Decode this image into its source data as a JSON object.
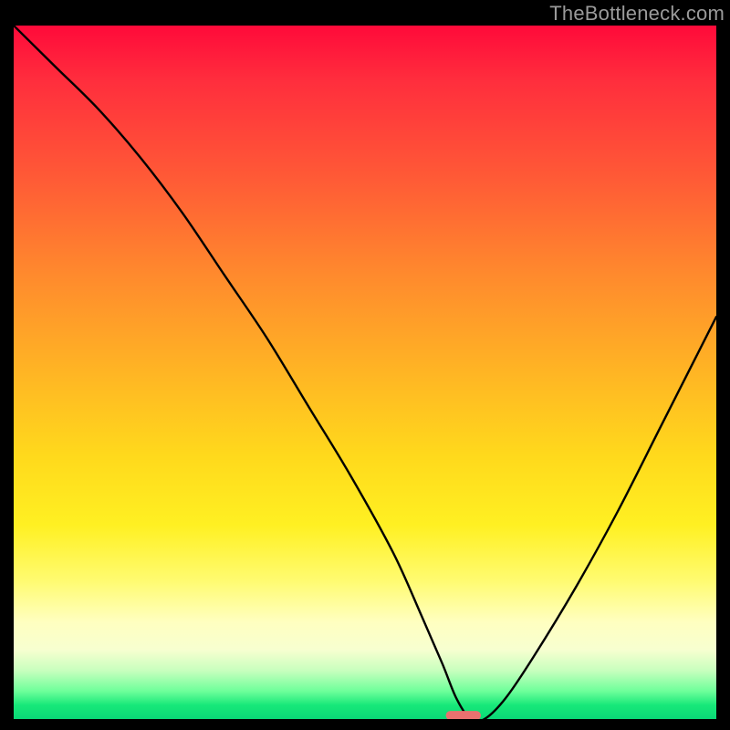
{
  "watermark": {
    "text": "TheBottleneck.com"
  },
  "chart_data": {
    "type": "line",
    "title": "",
    "xlabel": "",
    "ylabel": "",
    "xlim": [
      0,
      100
    ],
    "ylim": [
      0,
      100
    ],
    "grid": false,
    "legend": false,
    "annotations": [],
    "series": [
      {
        "name": "bottleneck-curve",
        "x": [
          0,
          6,
          12,
          18,
          24,
          30,
          36,
          42,
          48,
          54,
          58,
          61,
          63,
          65,
          67,
          70,
          74,
          80,
          86,
          92,
          97,
          100
        ],
        "values": [
          100,
          94,
          88,
          81,
          73,
          64,
          55,
          45,
          35,
          24,
          15,
          8,
          3,
          0,
          0,
          3,
          9,
          19,
          30,
          42,
          52,
          58
        ],
        "color": "#000000",
        "stroke_width": 2.4
      }
    ],
    "marker": {
      "name": "optimum-marker",
      "x": 64,
      "y": 0,
      "width": 5,
      "height": 1.3,
      "color": "#e9716f"
    },
    "background": {
      "type": "vertical-gradient",
      "stops": [
        {
          "pos": 0,
          "color": "#ff0a3a"
        },
        {
          "pos": 50,
          "color": "#ffb524"
        },
        {
          "pos": 80,
          "color": "#fffb70"
        },
        {
          "pos": 96,
          "color": "#6dff9a"
        },
        {
          "pos": 100,
          "color": "#0ad877"
        }
      ]
    }
  }
}
